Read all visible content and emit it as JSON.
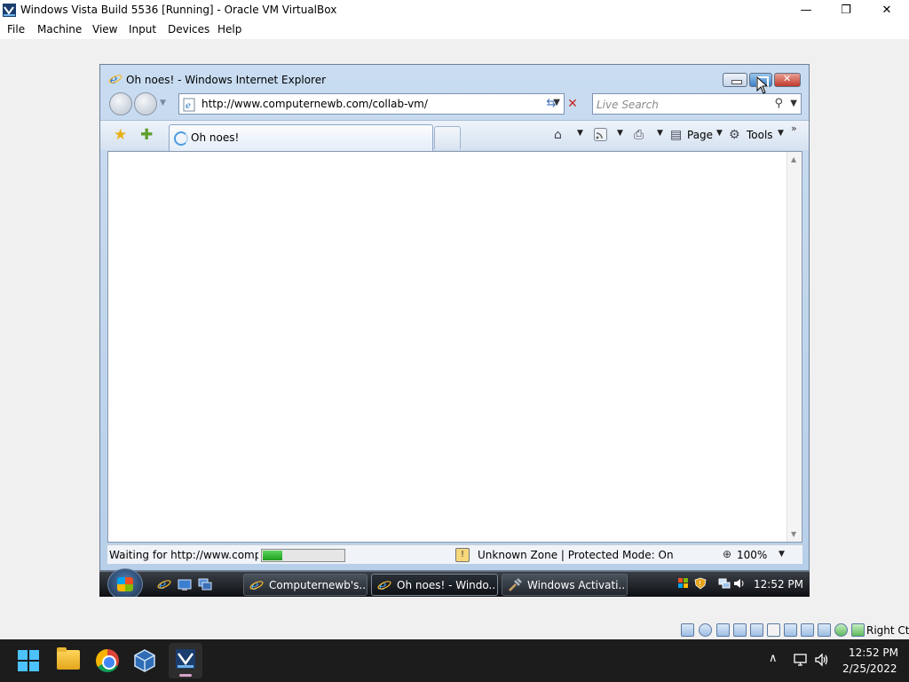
{
  "host_window": {
    "title": "Windows Vista Build 5536 [Running] - Oracle VM VirtualBox",
    "minimize_glyph": "—",
    "restore_glyph": "❐",
    "close_glyph": "✕"
  },
  "host_menu": [
    "File",
    "Machine",
    "View",
    "Input",
    "Devices",
    "Help"
  ],
  "ie": {
    "window_title": "Oh noes! - Windows Internet Explorer",
    "address_url": "http://www.computernewb.com/collab-vm/",
    "search_placeholder": "Live Search",
    "tab_label": "Oh noes!",
    "commands": {
      "page": "Page",
      "tools": "Tools"
    },
    "status": {
      "text": "Waiting for http://www.computernewb.com/collab-vm/...",
      "progress_fraction": 0.24,
      "zone": "Unknown Zone | Protected Mode: On",
      "zoom": "100%"
    }
  },
  "vista_taskbar": {
    "buttons": [
      {
        "label": "Computernewb's...",
        "icon": "ie-icon",
        "active": false
      },
      {
        "label": "Oh noes! - Windo...",
        "icon": "ie-icon",
        "active": true
      },
      {
        "label": "Windows Activati...",
        "icon": "activation-icon",
        "active": false
      }
    ],
    "clock": "12:52 PM"
  },
  "vbox_status": {
    "host_key": "Right Ctrl"
  },
  "host_taskbar": {
    "time": "12:52 PM",
    "date": "2/25/2022",
    "overflow_glyph": "∧"
  },
  "colors": {
    "win11_accent": "#4cc2ff",
    "ie_frame": "#c9dcf1",
    "progress_green": "#1ea01e",
    "close_red": "#c0392b"
  }
}
